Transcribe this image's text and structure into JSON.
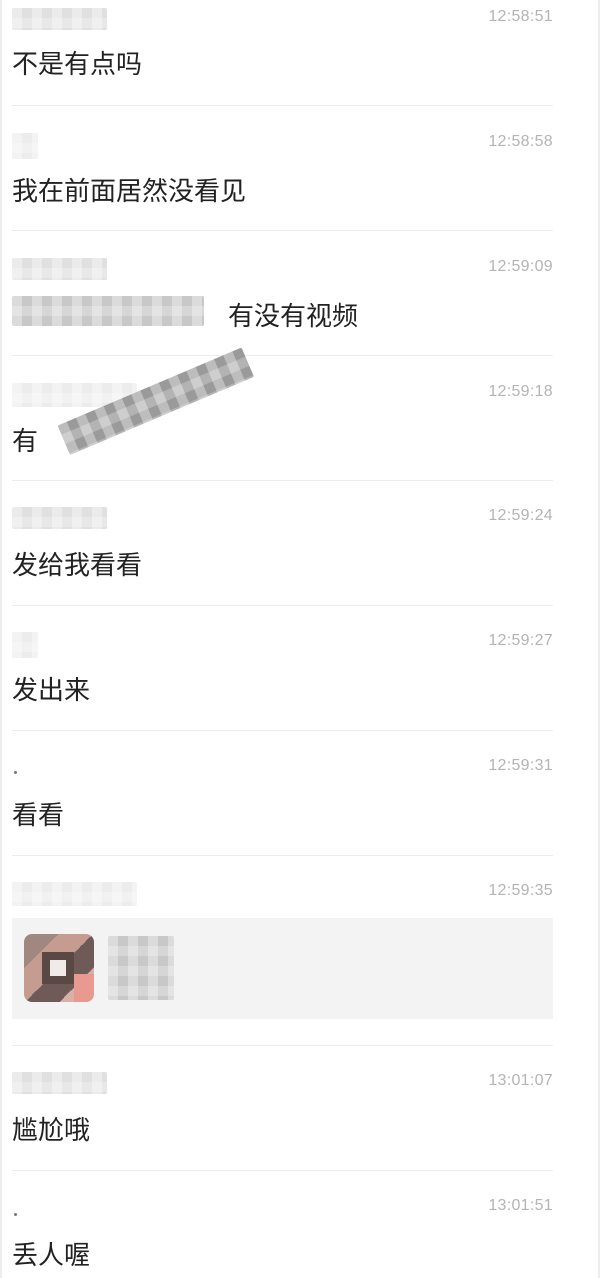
{
  "messages": [
    {
      "time": "12:58:51",
      "text": "不是有点吗"
    },
    {
      "time": "12:58:58",
      "text": "我在前面居然没看见"
    },
    {
      "time": "12:59:09",
      "text": "有没有视频"
    },
    {
      "time": "12:59:18",
      "text": "有"
    },
    {
      "time": "12:59:24",
      "text": "发给我看看"
    },
    {
      "time": "12:59:27",
      "text": "发出来"
    },
    {
      "time": "12:59:31",
      "text": "看看"
    },
    {
      "time": "12:59:35",
      "text": ""
    },
    {
      "time": "13:01:07",
      "text": "尴尬哦"
    },
    {
      "time": "13:01:51",
      "text": "丢人喔"
    }
  ],
  "icons": {
    "card_thumbnail": "shared-media-thumbnail"
  }
}
